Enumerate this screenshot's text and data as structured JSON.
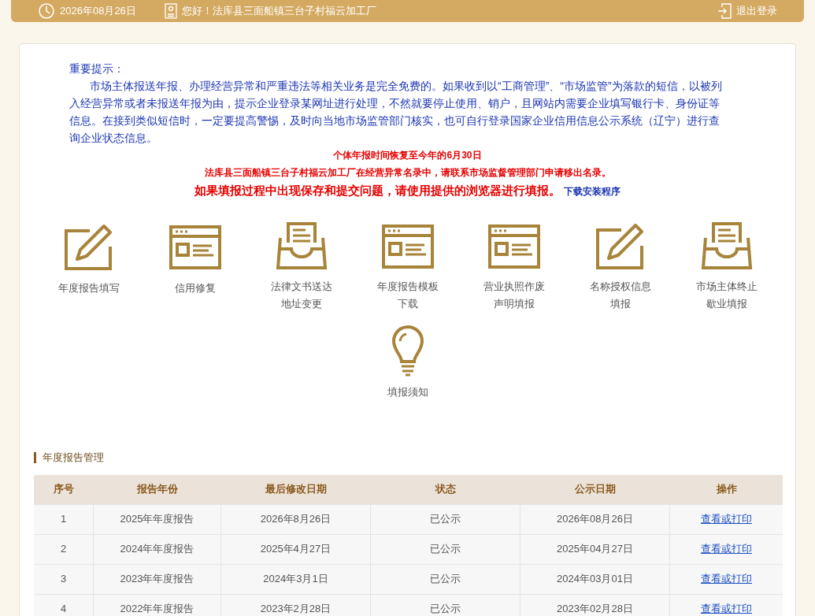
{
  "header": {
    "date": "2026年08月26日",
    "greeting": "您好！法库县三面船镇三台子村福云加工厂",
    "logout": "退出登录"
  },
  "notice": {
    "title": "重要提示：",
    "paragraph": "市场主体报送年报、办理经营异常和严重违法等相关业务是完全免费的。如果收到以“工商管理”、“市场监管”为落款的短信，以被列入经营异常或者未报送年报为由，提示企业登录某网址进行处理，不然就要停止使用、销户，且网站内需要企业填写银行卡、身份证等信息。在接到类似短信时，一定要提高警惕，及时向当地市场监管部门核实，也可自行登录国家企业信用信息公示系统（辽宁）进行查询企业状态信息。",
    "alerts": [
      {
        "kind": "small",
        "text": "个体年报时间恢复至今年的6月30日"
      },
      {
        "kind": "small",
        "text": "法库县三面船镇三台子村福云加工厂在经营异常名录中，请联系市场监督管理部门申请移出名录。"
      },
      {
        "kind": "large",
        "text": "如果填报过程中出现保存和提交问题，请使用提供的浏览器进行填报。",
        "link": "下载安装程序"
      }
    ]
  },
  "features": [
    {
      "kind": "edit",
      "lines": [
        "年度报告填写"
      ]
    },
    {
      "kind": "window",
      "lines": [
        "信用修复"
      ]
    },
    {
      "kind": "tray",
      "lines": [
        "法律文书送达",
        "地址变更"
      ]
    },
    {
      "kind": "window",
      "lines": [
        "年度报告模板",
        "下载"
      ]
    },
    {
      "kind": "window",
      "lines": [
        "营业执照作废",
        "声明填报"
      ]
    },
    {
      "kind": "edit",
      "lines": [
        "名称授权信息",
        "填报"
      ]
    },
    {
      "kind": "tray",
      "lines": [
        "市场主体终止",
        "歇业填报"
      ]
    },
    {
      "kind": "bulb",
      "lines": [
        "填报须知"
      ]
    }
  ],
  "section_title": "年度报告管理",
  "table": {
    "columns": [
      "序号",
      "报告年份",
      "最后修改日期",
      "状态",
      "公示日期",
      "操作"
    ],
    "rows": [
      {
        "cells": [
          "1",
          "2025年年度报告",
          "2026年8月26日",
          "已公示",
          "2026年08月26日"
        ],
        "action": "查看或打印"
      },
      {
        "cells": [
          "2",
          "2024年年度报告",
          "2025年4月27日",
          "已公示",
          "2025年04月27日"
        ],
        "action": "查看或打印"
      },
      {
        "cells": [
          "3",
          "2023年年度报告",
          "2024年3月1日",
          "已公示",
          "2024年03月01日"
        ],
        "action": "查看或打印"
      },
      {
        "cells": [
          "4",
          "2022年年度报告",
          "2023年2月28日",
          "已公示",
          "2023年02月28日"
        ],
        "action": "查看或打印"
      }
    ]
  }
}
